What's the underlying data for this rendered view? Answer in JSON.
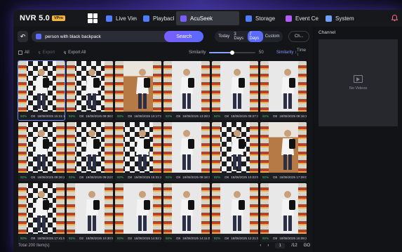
{
  "brand": {
    "name": "NVR 5.0",
    "badge": "VPro"
  },
  "nav": {
    "tabs": [
      {
        "label": "Live View",
        "icon": "live-view-icon",
        "color": "#4f7dff",
        "active": false
      },
      {
        "label": "Playback",
        "icon": "playback-icon",
        "color": "#4f7dff",
        "active": false
      },
      {
        "label": "AcuSeek",
        "icon": "acuseek-icon",
        "color": "#7a5cff",
        "active": true
      },
      {
        "label": "Storage",
        "icon": "storage-icon",
        "color": "#4f7dff",
        "active": false
      },
      {
        "label": "Event Ce",
        "icon": "event-center-icon",
        "color": "#b35cff",
        "active": false
      },
      {
        "label": "System c",
        "icon": "system-gear-icon",
        "color": "#6fa0ff",
        "active": false
      }
    ]
  },
  "search": {
    "query": "person with black backpack",
    "button_label": "Search",
    "ranges": [
      "Today",
      "3 Days",
      "7 Days",
      "Custom"
    ],
    "selected_range": "7 Days",
    "channel_button": "Ch..."
  },
  "toolbar": {
    "all_label": "All",
    "extract_label": "Export",
    "export_all_label": "Export All",
    "similarity_label": "Similarity",
    "similarity_value": "50",
    "similarity_fraction": 0.5,
    "sort_similarity": "Similarity",
    "sort_time": "Time"
  },
  "results": [
    {
      "score": "93%",
      "cam": "D8",
      "time": "18/08/2025 15:21:16",
      "scene": "checker"
    },
    {
      "score": "93%",
      "cam": "D8",
      "time": "18/08/2025 09:38:02",
      "scene": "checker"
    },
    {
      "score": "93%",
      "cam": "D8",
      "time": "18/08/2025 10:17:07",
      "scene": "wood"
    },
    {
      "score": "92%",
      "cam": "D8",
      "time": "18/08/2025 13:28:36",
      "scene": "aisle"
    },
    {
      "score": "92%",
      "cam": "D8",
      "time": "18/08/2025 09:27:34",
      "scene": "aisle"
    },
    {
      "score": "92%",
      "cam": "D8",
      "time": "18/08/2025 08:16:13",
      "scene": "aisle"
    },
    {
      "score": "92%",
      "cam": "D8",
      "time": "18/08/2025 08:26:29",
      "scene": "checker"
    },
    {
      "score": "92%",
      "cam": "D8",
      "time": "18/08/2025 09:23:08",
      "scene": "checker"
    },
    {
      "score": "92%",
      "cam": "D8",
      "time": "18/08/2025 15:31:28",
      "scene": "checker"
    },
    {
      "score": "92%",
      "cam": "D8",
      "time": "18/08/2025 09:18:35",
      "scene": "aisle"
    },
    {
      "score": "92%",
      "cam": "D8",
      "time": "18/08/2025 10:03:56",
      "scene": "checker"
    },
    {
      "score": "92%",
      "cam": "D8",
      "time": "18/08/2025 17:09:07",
      "scene": "wood"
    },
    {
      "score": "92%",
      "cam": "D8",
      "time": "18/08/2025 17:41:52",
      "scene": "checker"
    },
    {
      "score": "92%",
      "cam": "D2",
      "time": "18/08/2025 10:30:58",
      "scene": "aisle"
    },
    {
      "score": "92%",
      "cam": "D2",
      "time": "18/08/2025 14:52:21",
      "scene": "aisle"
    },
    {
      "score": "92%",
      "cam": "D8",
      "time": "18/08/2025 14:11:07",
      "scene": "aisle"
    },
    {
      "score": "92%",
      "cam": "D8",
      "time": "18/08/2025 12:21:56",
      "scene": "aisle"
    },
    {
      "score": "92%",
      "cam": "D8",
      "time": "18/08/2025 16:09:23",
      "scene": "aisle"
    }
  ],
  "footer": {
    "total": "Total 200 Item(s)",
    "page_current": "1",
    "page_total": "/12",
    "go_label": "GO"
  },
  "channel_panel": {
    "title": "Channel",
    "empty_label": "No Videos"
  }
}
